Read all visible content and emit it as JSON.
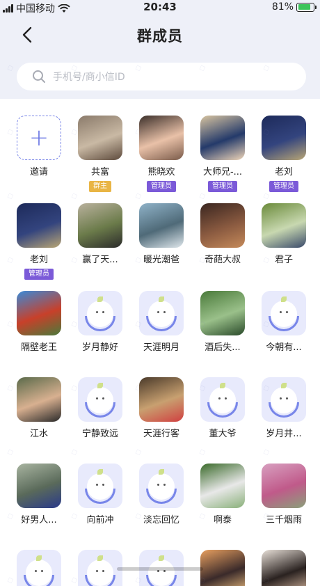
{
  "status": {
    "carrier": "中国移动",
    "time": "20:43",
    "battery": "81%"
  },
  "header": {
    "title": "群成员"
  },
  "search": {
    "placeholder": "手机号/商小信ID"
  },
  "members": [
    {
      "name": "邀请",
      "avatar": "add",
      "badge": ""
    },
    {
      "name": "共富",
      "avatar": "photo",
      "badge": "群主",
      "badge_type": "owner",
      "colors": [
        "#8a7a6a",
        "#c9b9a4",
        "#5d4a3c"
      ]
    },
    {
      "name": "熊晓欢",
      "avatar": "photo",
      "badge": "管理员",
      "badge_type": "admin",
      "colors": [
        "#3b2f2a",
        "#e9c1a8",
        "#7a5b4a"
      ]
    },
    {
      "name": "大师兄-...",
      "avatar": "photo",
      "badge": "管理员",
      "badge_type": "admin",
      "colors": [
        "#d8c4a0",
        "#243a6a",
        "#f0d6b8"
      ]
    },
    {
      "name": "老刘",
      "avatar": "photo",
      "badge": "管理员",
      "badge_type": "admin",
      "colors": [
        "#1d2a5a",
        "#33447e",
        "#b9a675"
      ]
    },
    {
      "name": "老刘",
      "avatar": "photo",
      "badge": "管理员",
      "badge_type": "admin",
      "colors": [
        "#1d2a5a",
        "#33447e",
        "#b9a675"
      ]
    },
    {
      "name": "赢了天...",
      "avatar": "photo",
      "badge": "",
      "colors": [
        "#b9b19d",
        "#6b7b4a",
        "#2b2b2b"
      ]
    },
    {
      "name": "暖光潮爸",
      "avatar": "photo",
      "badge": "",
      "colors": [
        "#8fb2c8",
        "#4f6a78",
        "#dfe7ec"
      ]
    },
    {
      "name": "奇葩大叔",
      "avatar": "photo",
      "badge": "",
      "colors": [
        "#3a2620",
        "#8a5a40",
        "#c58a5a"
      ]
    },
    {
      "name": "君子",
      "avatar": "photo",
      "badge": "",
      "colors": [
        "#6a8a3a",
        "#c8d8b0",
        "#3a4a6a"
      ]
    },
    {
      "name": "隔壁老王",
      "avatar": "photo",
      "badge": "",
      "colors": [
        "#3a8ad8",
        "#c8402a",
        "#4a7a3a"
      ]
    },
    {
      "name": "岁月静好",
      "avatar": "default",
      "badge": ""
    },
    {
      "name": "天涯明月",
      "avatar": "default",
      "badge": ""
    },
    {
      "name": "酒后失...",
      "avatar": "photo",
      "badge": "",
      "colors": [
        "#4a7a3a",
        "#9ac08a",
        "#2a4a2a"
      ]
    },
    {
      "name": "今朝有...",
      "avatar": "default",
      "badge": ""
    },
    {
      "name": "江水",
      "avatar": "photo",
      "badge": "",
      "colors": [
        "#5a6a4a",
        "#d8b090",
        "#2a2a2a"
      ]
    },
    {
      "name": "宁静致远",
      "avatar": "default",
      "badge": ""
    },
    {
      "name": "天涯行客",
      "avatar": "photo",
      "badge": "",
      "colors": [
        "#4a3a2a",
        "#c8a070",
        "#d04040"
      ]
    },
    {
      "name": "董大爷",
      "avatar": "default",
      "badge": ""
    },
    {
      "name": "岁月井...",
      "avatar": "default",
      "badge": ""
    },
    {
      "name": "好男人...",
      "avatar": "photo",
      "badge": "",
      "colors": [
        "#a8b4a0",
        "#5a6a5a",
        "#2a3a8a"
      ]
    },
    {
      "name": "向前冲",
      "avatar": "default",
      "badge": ""
    },
    {
      "name": "淡忘回忆",
      "avatar": "default",
      "badge": ""
    },
    {
      "name": "啊泰",
      "avatar": "photo",
      "badge": "",
      "colors": [
        "#3a6a2a",
        "#e8e8e8",
        "#8ab07a"
      ]
    },
    {
      "name": "三千烟雨",
      "avatar": "photo",
      "badge": "",
      "colors": [
        "#d8a0c0",
        "#c05a8a",
        "#8aa07a"
      ]
    },
    {
      "name": "",
      "avatar": "default",
      "badge": ""
    },
    {
      "name": "",
      "avatar": "default",
      "badge": ""
    },
    {
      "name": "",
      "avatar": "default",
      "badge": ""
    },
    {
      "name": "",
      "avatar": "photo",
      "badge": "",
      "colors": [
        "#e8a060",
        "#3a2a2a",
        "#f0c080"
      ]
    },
    {
      "name": "",
      "avatar": "photo",
      "badge": "",
      "colors": [
        "#e8e0d8",
        "#2a2220",
        "#d8b8a0"
      ]
    }
  ],
  "icons": {
    "back": "chevron-left-icon",
    "search": "search-icon",
    "add": "plus-icon"
  }
}
